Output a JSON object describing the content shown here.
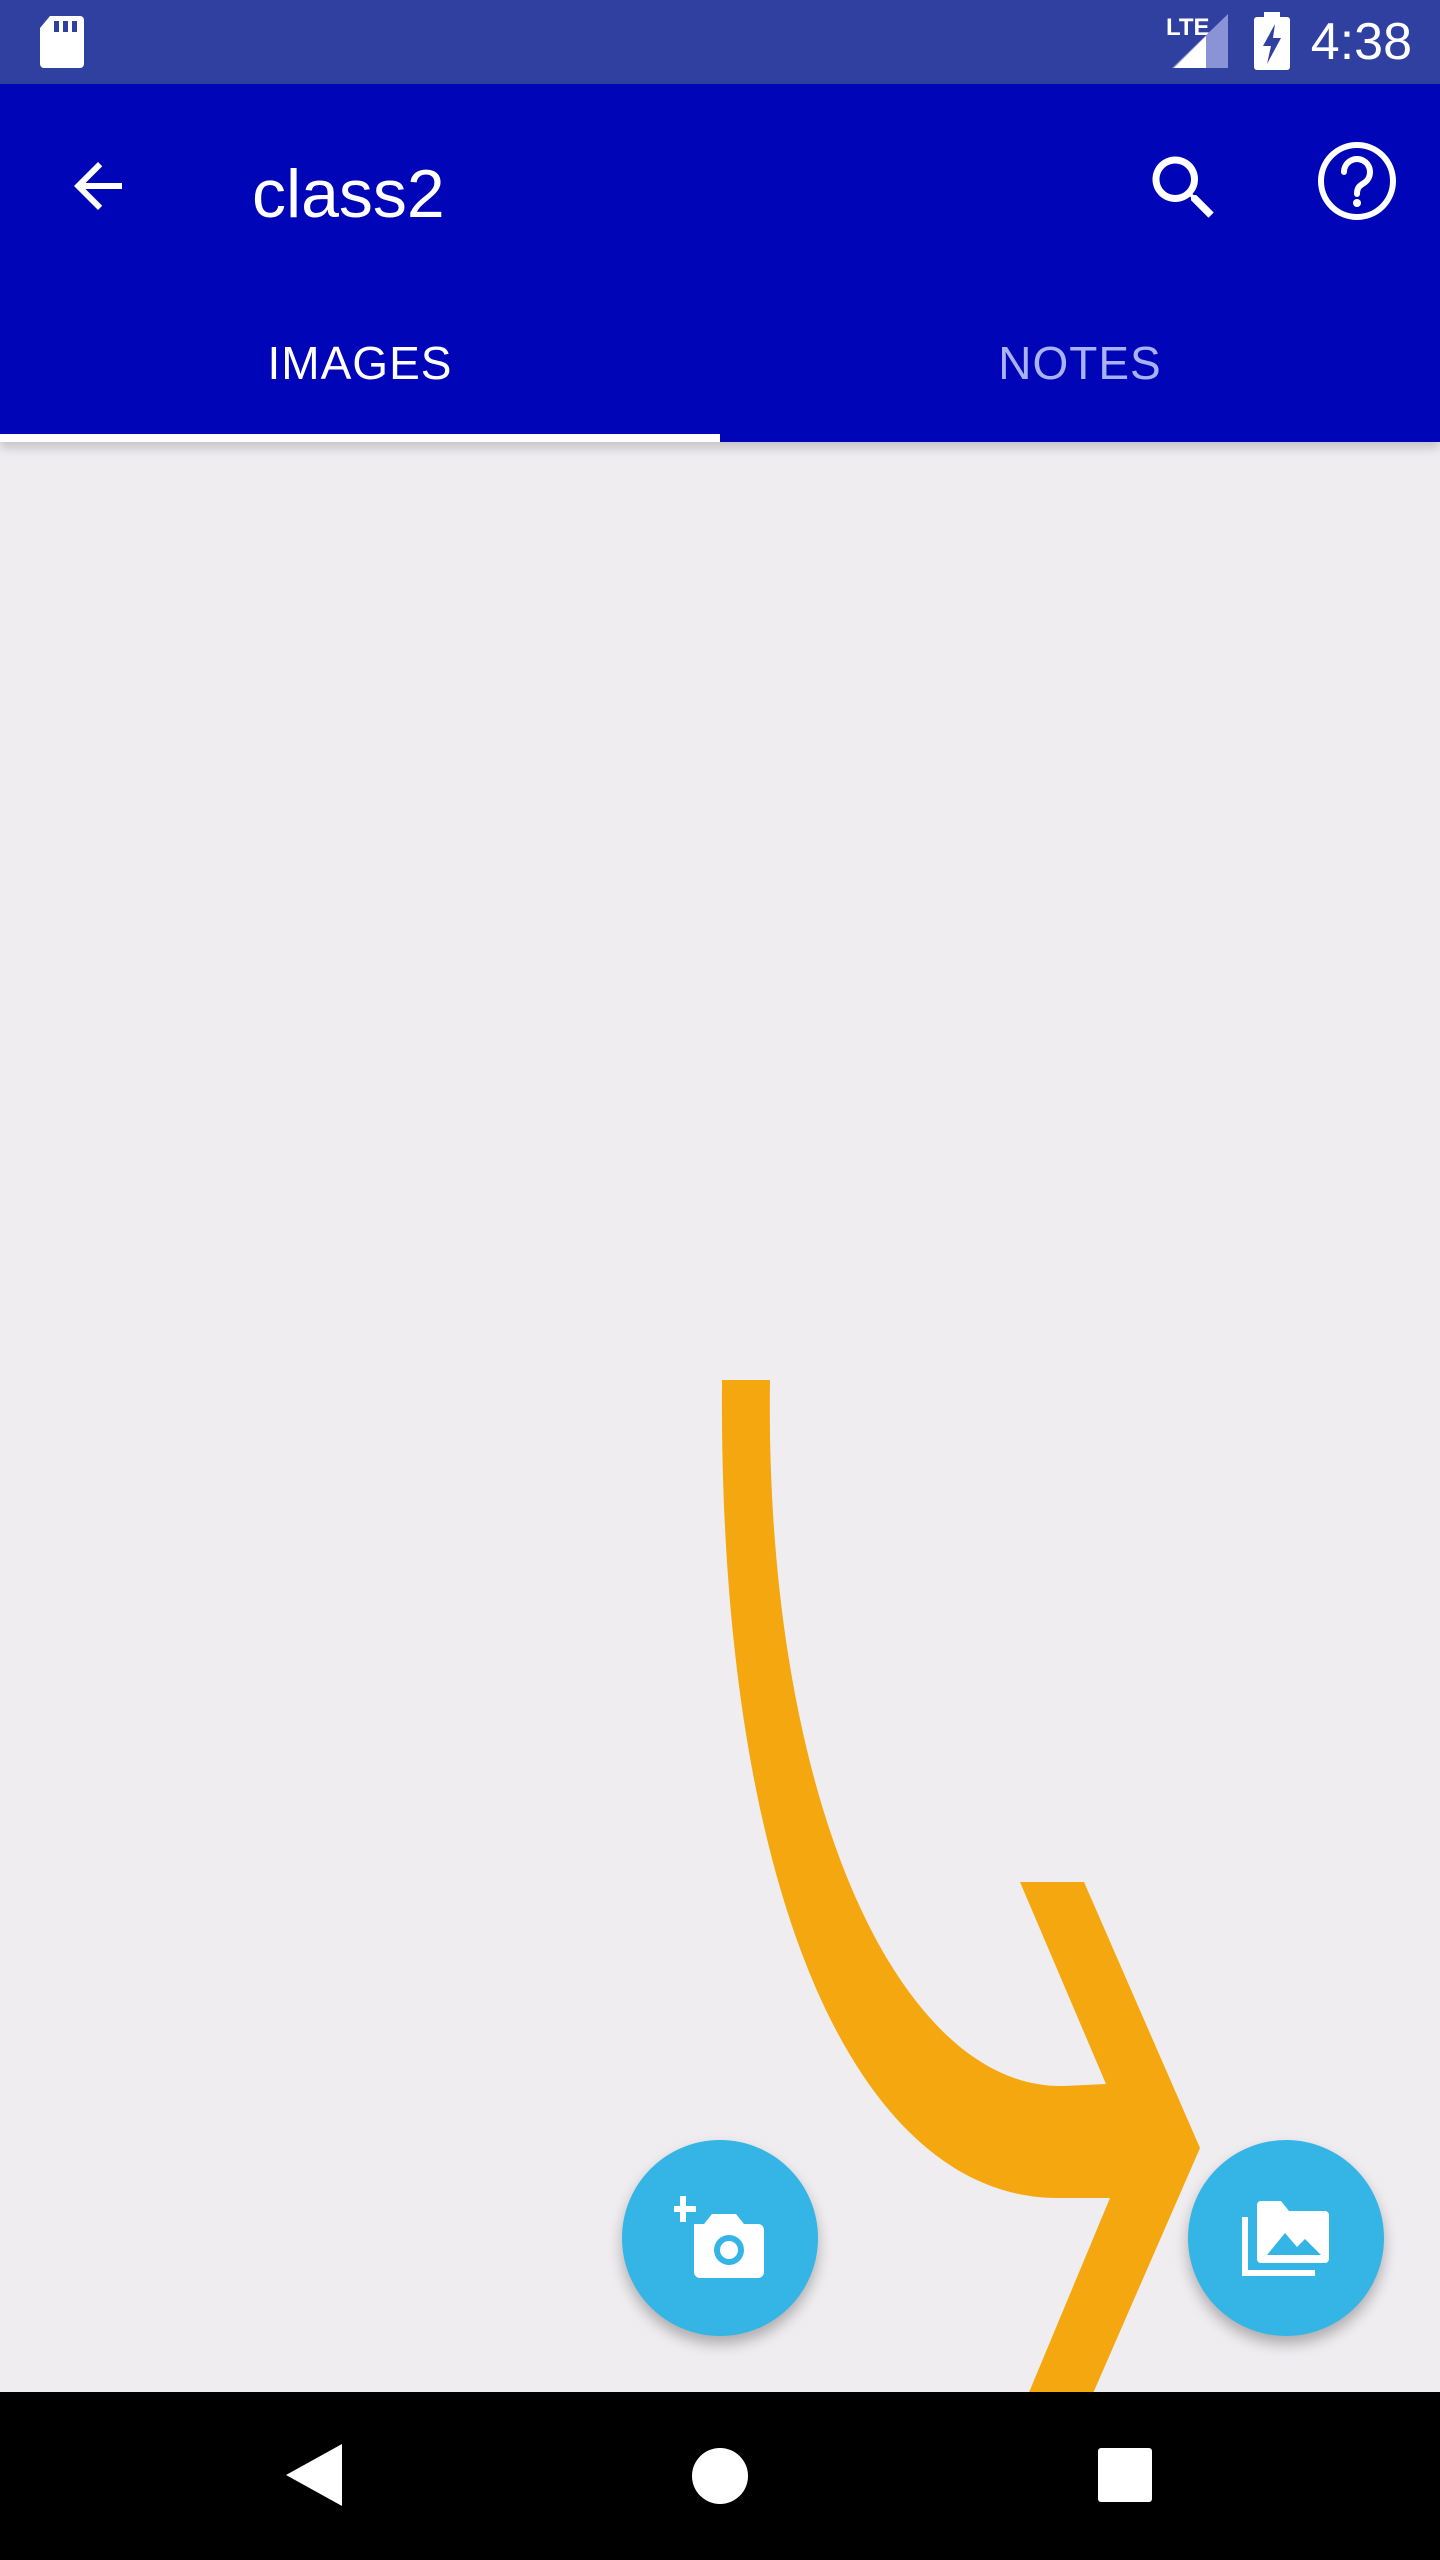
{
  "status_bar": {
    "time": "4:38",
    "network_label": "LTE",
    "icons": [
      "sd-card-icon",
      "signal-icon",
      "battery-charging-icon"
    ]
  },
  "app_bar": {
    "title": "class2",
    "back_icon": "arrow-left-icon",
    "search_icon": "search-icon",
    "help_icon": "help-circle-icon"
  },
  "tabs": [
    {
      "label": "IMAGES",
      "selected": true
    },
    {
      "label": "NOTES",
      "selected": false
    }
  ],
  "fabs": {
    "camera_icon": "add-a-photo-icon",
    "gallery_icon": "photo-library-folder-icon"
  },
  "annotation": {
    "arrow_color": "#f4a70f",
    "icon": "curved-arrow-icon"
  },
  "colors": {
    "app_bar": "#0005b8",
    "status_bar": "#3040a0",
    "fab": "#35b4e6",
    "background": "#efedf0"
  },
  "nav_bar": {
    "icons": [
      "back-triangle-icon",
      "home-circle-icon",
      "recents-square-icon"
    ]
  }
}
